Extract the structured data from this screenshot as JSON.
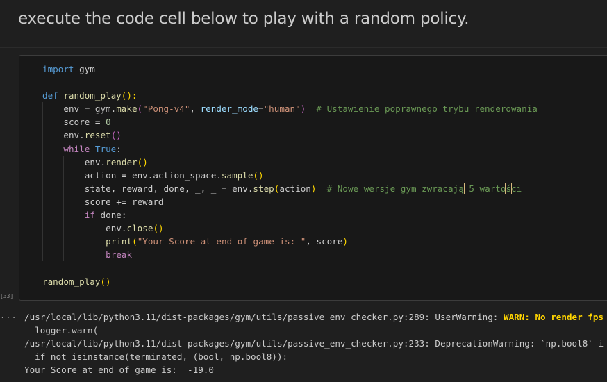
{
  "markdown": {
    "text": "execute the code cell below to play with a random policy."
  },
  "cell": {
    "execution_count": "[33]",
    "code_lines": [
      [
        {
          "t": "import",
          "c": "kw"
        },
        {
          "t": " gym"
        }
      ],
      [],
      [
        {
          "t": "def",
          "c": "kw"
        },
        {
          "t": " "
        },
        {
          "t": "random_play",
          "c": "fn"
        },
        {
          "t": "(",
          "c": "p1"
        },
        {
          "t": "):",
          "c": "p1"
        }
      ],
      [
        {
          "i": 1
        },
        {
          "t": "env = gym."
        },
        {
          "t": "make",
          "c": "fn"
        },
        {
          "t": "(",
          "c": "p2"
        },
        {
          "t": "\"Pong-v4\"",
          "c": "str"
        },
        {
          "t": ", "
        },
        {
          "t": "render_mode",
          "c": "prm"
        },
        {
          "t": "="
        },
        {
          "t": "\"human\"",
          "c": "str"
        },
        {
          "t": ")",
          "c": "p2"
        },
        {
          "t": "  "
        },
        {
          "t": "# Ustawienie poprawnego trybu renderowania",
          "c": "cmt"
        }
      ],
      [
        {
          "i": 1
        },
        {
          "t": "score = "
        },
        {
          "t": "0",
          "c": "num"
        }
      ],
      [
        {
          "i": 1
        },
        {
          "t": "env."
        },
        {
          "t": "reset",
          "c": "fn"
        },
        {
          "t": "()",
          "c": "p2"
        }
      ],
      [
        {
          "i": 1
        },
        {
          "t": "while",
          "c": "ctl"
        },
        {
          "t": " "
        },
        {
          "t": "True",
          "c": "kw"
        },
        {
          "t": ":"
        }
      ],
      [
        {
          "i": 2
        },
        {
          "t": "env."
        },
        {
          "t": "render",
          "c": "fn"
        },
        {
          "t": "()",
          "c": "p1"
        }
      ],
      [
        {
          "i": 2
        },
        {
          "t": "action = env.action_space."
        },
        {
          "t": "sample",
          "c": "fn"
        },
        {
          "t": "()",
          "c": "p1"
        }
      ],
      [
        {
          "i": 2
        },
        {
          "t": "state, reward, done, _, _ = env."
        },
        {
          "t": "step",
          "c": "fn"
        },
        {
          "t": "(",
          "c": "p1"
        },
        {
          "t": "action"
        },
        {
          "t": ")",
          "c": "p1"
        },
        {
          "t": "  "
        },
        {
          "t": "# Nowe wersje gym zwracaj",
          "c": "cmt"
        },
        {
          "t": "ą",
          "c": "cmt bad"
        },
        {
          "t": " 5 warto",
          "c": "cmt"
        },
        {
          "t": "ś",
          "c": "cmt bad"
        },
        {
          "t": "ci",
          "c": "cmt"
        }
      ],
      [
        {
          "i": 2
        },
        {
          "t": "score += reward"
        }
      ],
      [
        {
          "i": 2
        },
        {
          "t": "if",
          "c": "ctl"
        },
        {
          "t": " done:"
        }
      ],
      [
        {
          "i": 3
        },
        {
          "t": "env."
        },
        {
          "t": "close",
          "c": "fn"
        },
        {
          "t": "()",
          "c": "p1"
        }
      ],
      [
        {
          "i": 3
        },
        {
          "t": "print",
          "c": "fn"
        },
        {
          "t": "(",
          "c": "p1"
        },
        {
          "t": "\"Your Score at end of game is: \"",
          "c": "str"
        },
        {
          "t": ", score"
        },
        {
          "t": ")",
          "c": "p1"
        }
      ],
      [
        {
          "i": 3
        },
        {
          "t": "break",
          "c": "ctl"
        }
      ],
      [],
      [
        {
          "t": "random_play",
          "c": "fn"
        },
        {
          "t": "()",
          "c": "p1"
        }
      ]
    ]
  },
  "output": {
    "dots": "...",
    "lines": [
      [
        {
          "t": "/usr/local/lib/python3.11/dist-packages/gym/utils/passive_env_checker.py:289: UserWarning: "
        },
        {
          "t": "WARN: No render fps",
          "c": "warn"
        }
      ],
      [
        {
          "t": "  logger.warn("
        }
      ],
      [
        {
          "t": "/usr/local/lib/python3.11/dist-packages/gym/utils/passive_env_checker.py:233: DeprecationWarning: `np.bool8` i"
        }
      ],
      [
        {
          "t": "  if not isinstance(terminated, (bool, np.bool8)):"
        }
      ],
      [
        {
          "t": "Your Score at end of game is:  -19.0"
        }
      ]
    ]
  }
}
